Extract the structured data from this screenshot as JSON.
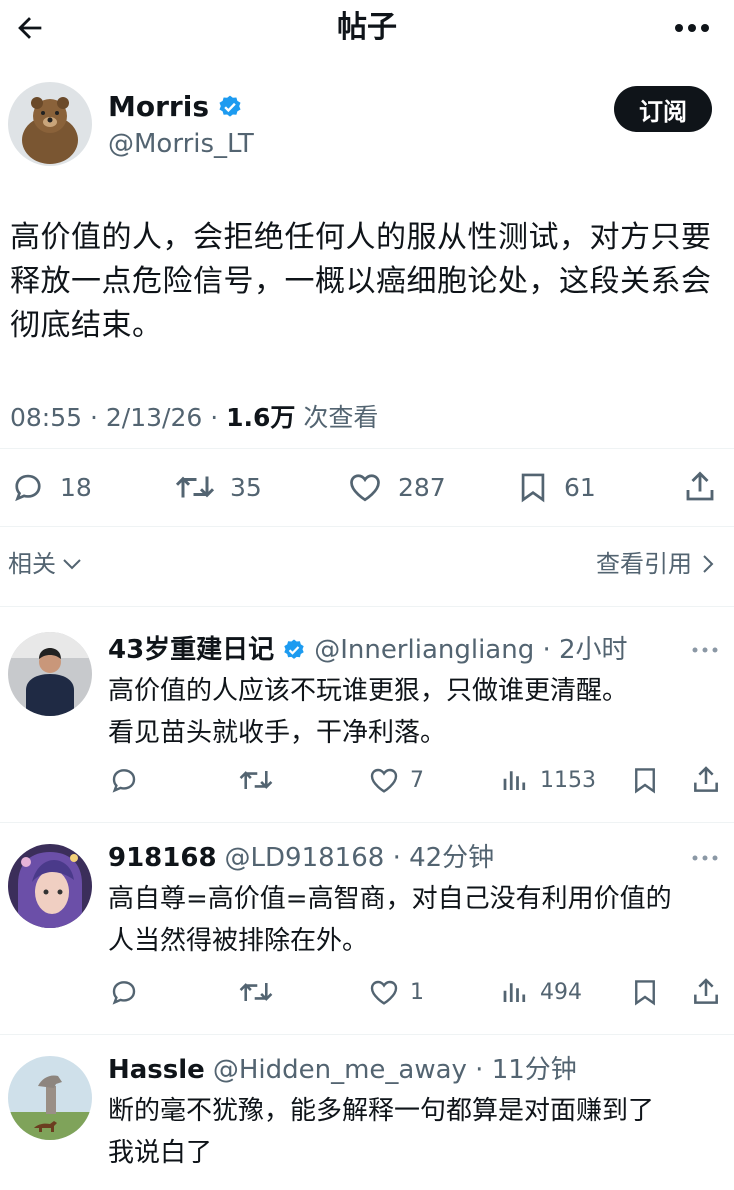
{
  "header": {
    "title": "帖子"
  },
  "post": {
    "author_name": "Morris",
    "author_handle": "@Morris_LT",
    "subscribe_label": "订阅",
    "body": "高价值的人，会拒绝任何人的服从性测试，对方只要释放一点危险信号，一概以癌细胞论处，这段关系会彻底结束。",
    "time_date": "08:55 · 2/13/26 · ",
    "views": "1.6万",
    "views_suffix": " 次查看",
    "replies": "18",
    "reposts": "35",
    "likes": "287",
    "bookmarks": "61"
  },
  "related_label": "相关",
  "view_quotes_label": "查看引用",
  "replies": [
    {
      "name": "43岁重建日记",
      "handle": "@Innerliangliang · 2小时",
      "text_line1": "高价值的人应该不玩谁更狠，只做谁更清醒。",
      "text_line2": "看见苗头就收手，干净利落。",
      "likes": "7",
      "views": "1153"
    },
    {
      "name": "918168",
      "handle": "@LD918168 · 42分钟",
      "text_line1": "高自尊=高价值=高智商，对自己没有利用价值的",
      "text_line2": "人当然得被排除在外。",
      "likes": "1",
      "views": "494"
    },
    {
      "name": "Hassle",
      "handle": "@Hidden_me_away · 11分钟",
      "text_line1": "断的毫不犹豫，能多解释一句都算是对面赚到了",
      "text_line2": "我说白了"
    }
  ],
  "colors": {
    "text": "#0f1419",
    "secondary": "#536471",
    "verified": "#1d9bf0",
    "button": "#0f1419"
  },
  "icons": [
    "arrow-left-icon",
    "more-horizontal-icon",
    "verified-badge-icon",
    "reply-icon",
    "repost-icon",
    "like-icon",
    "bookmark-icon",
    "share-icon",
    "chevron-down-icon",
    "chevron-right-icon",
    "views-icon"
  ]
}
